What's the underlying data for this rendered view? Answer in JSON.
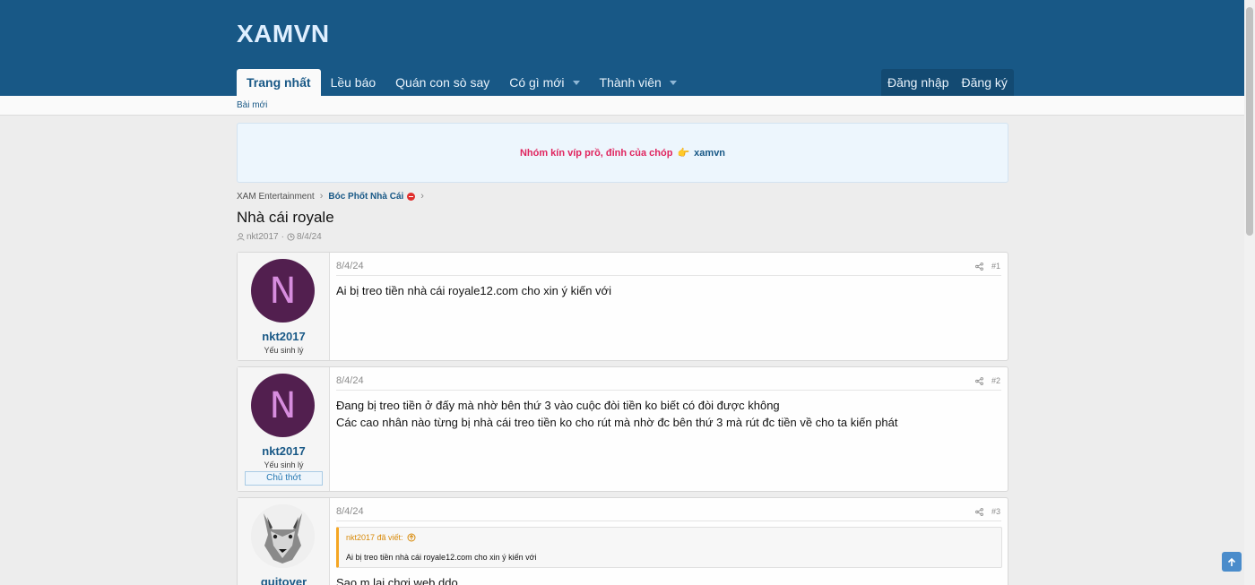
{
  "site": {
    "logo": "XAMVN"
  },
  "nav": {
    "items": [
      {
        "label": "Trang nhất",
        "active": true
      },
      {
        "label": "Lều báo"
      },
      {
        "label": "Quán con sò say"
      },
      {
        "label": "Có gì mới",
        "dropdown": true
      },
      {
        "label": "Thành viên",
        "dropdown": true
      }
    ],
    "login": "Đăng nhập",
    "register": "Đăng ký"
  },
  "subnav": {
    "new_posts": "Bài mới"
  },
  "notice": {
    "text": "Nhóm kín víp prồ, đỉnh của chóp",
    "emoji": "👉",
    "link": "xamvn"
  },
  "breadcrumb": {
    "items": [
      "XAM Entertainment",
      "Bóc Phốt Nhà Cái"
    ]
  },
  "thread": {
    "title": "Nhà cái royale",
    "author": "nkt2017",
    "date": "8/4/24"
  },
  "posts": [
    {
      "username": "nkt2017",
      "avatar_letter": "N",
      "user_title": "Yếu sinh lý",
      "date": "8/4/24",
      "number": "#1",
      "lines": [
        "Ai bị treo tiền nhà cái royale12.com cho xin ý kiến với"
      ]
    },
    {
      "username": "nkt2017",
      "avatar_letter": "N",
      "user_title": "Yếu sinh lý",
      "banner": "Chủ thớt",
      "date": "8/4/24",
      "number": "#2",
      "lines": [
        "Đang bị treo tiền ở đấy mà nhờ bên thứ 3 vào cuộc đòi tiền ko biết có đòi được không",
        "Các cao nhân nào từng bị nhà cái treo tiền ko cho rút mà nhờ đc bên thứ 3 mà rút đc tiền về cho ta kiến phát"
      ]
    },
    {
      "username": "guitover",
      "date": "8/4/24",
      "number": "#3",
      "quote_head": "nkt2017 đã viết:",
      "quote_text": "Ai bị treo tiền nhà cái royale12.com cho xin ý kiến với",
      "lines": [
        "Sao m lại chơi web ddo"
      ]
    }
  ],
  "colors": {
    "header": "#185886",
    "accent_link": "#185886",
    "notice_pink": "#e0245e",
    "avatar_bg": "#521f4f"
  }
}
